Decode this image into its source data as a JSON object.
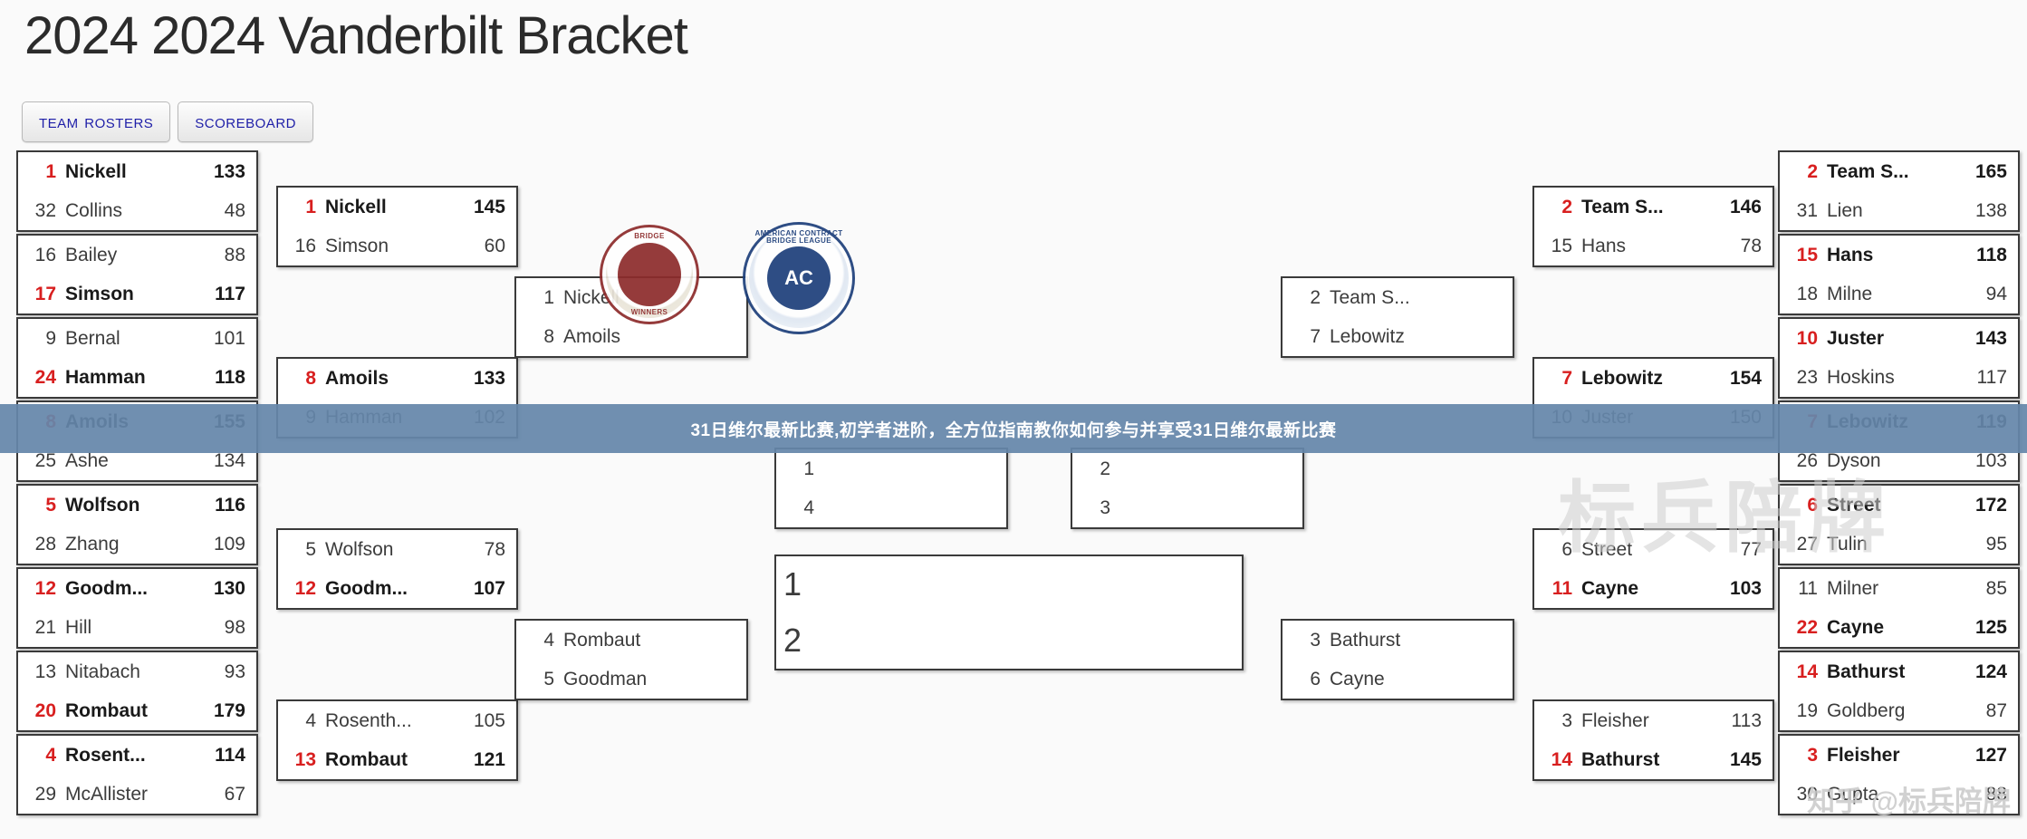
{
  "header": {
    "title": "2024 2024 Vanderbilt Bracket"
  },
  "tabs": [
    {
      "label": "Team Rosters"
    },
    {
      "label": "Scoreboard"
    }
  ],
  "overlay": {
    "banner_text": "31日维尔最新比赛,初学者进阶，全方位指南教你如何参与并享受31日维尔最新比赛",
    "watermark": "知乎 @标兵陪牌",
    "watermark_big": "标兵陪牌"
  },
  "logos": [
    {
      "name": "bridge-winners",
      "top_text": "BRIDGE",
      "bottom_text": "WINNERS"
    },
    {
      "name": "acbl",
      "top_text": "AMERICAN CONTRACT BRIDGE LEAGUE",
      "center": "AC"
    }
  ],
  "bracket": {
    "left_r1": [
      {
        "top": {
          "seed": "1",
          "name": "Nickell",
          "score": "133",
          "winner": true
        },
        "bot": {
          "seed": "32",
          "name": "Collins",
          "score": "48",
          "winner": false
        }
      },
      {
        "top": {
          "seed": "16",
          "name": "Bailey",
          "score": "88",
          "winner": false
        },
        "bot": {
          "seed": "17",
          "name": "Simson",
          "score": "117",
          "winner": true
        }
      },
      {
        "top": {
          "seed": "9",
          "name": "Bernal",
          "score": "101",
          "winner": false
        },
        "bot": {
          "seed": "24",
          "name": "Hamman",
          "score": "118",
          "winner": true
        }
      },
      {
        "top": {
          "seed": "8",
          "name": "Amoils",
          "score": "155",
          "winner": true
        },
        "bot": {
          "seed": "25",
          "name": "Ashe",
          "score": "134",
          "winner": false
        }
      },
      {
        "top": {
          "seed": "5",
          "name": "Wolfson",
          "score": "116",
          "winner": true
        },
        "bot": {
          "seed": "28",
          "name": "Zhang",
          "score": "109",
          "winner": false
        }
      },
      {
        "top": {
          "seed": "12",
          "name": "Goodm...",
          "score": "130",
          "winner": true
        },
        "bot": {
          "seed": "21",
          "name": "Hill",
          "score": "98",
          "winner": false
        }
      },
      {
        "top": {
          "seed": "13",
          "name": "Nitabach",
          "score": "93",
          "winner": false
        },
        "bot": {
          "seed": "20",
          "name": "Rombaut",
          "score": "179",
          "winner": true
        }
      },
      {
        "top": {
          "seed": "4",
          "name": "Rosent...",
          "score": "114",
          "winner": true
        },
        "bot": {
          "seed": "29",
          "name": "McAllister",
          "score": "67",
          "winner": false
        }
      }
    ],
    "left_r2": [
      {
        "top": {
          "seed": "1",
          "name": "Nickell",
          "score": "145",
          "winner": true
        },
        "bot": {
          "seed": "16",
          "name": "Simson",
          "score": "60",
          "winner": false
        }
      },
      {
        "top": {
          "seed": "8",
          "name": "Amoils",
          "score": "133",
          "winner": true
        },
        "bot": {
          "seed": "9",
          "name": "Hamman",
          "score": "102",
          "winner": false
        }
      },
      {
        "top": {
          "seed": "5",
          "name": "Wolfson",
          "score": "78",
          "winner": false
        },
        "bot": {
          "seed": "12",
          "name": "Goodm...",
          "score": "107",
          "winner": true
        }
      },
      {
        "top": {
          "seed": "4",
          "name": "Rosenth...",
          "score": "105",
          "winner": false
        },
        "bot": {
          "seed": "13",
          "name": "Rombaut",
          "score": "121",
          "winner": true
        }
      }
    ],
    "left_r3": [
      {
        "top": {
          "seed": "1",
          "name": "Nickell",
          "score": "",
          "winner": false
        },
        "bot": {
          "seed": "8",
          "name": "Amoils",
          "score": "",
          "winner": false
        }
      },
      {
        "top": {
          "seed": "4",
          "name": "Rombaut",
          "score": "",
          "winner": false
        },
        "bot": {
          "seed": "5",
          "name": "Goodman",
          "score": "",
          "winner": false
        }
      }
    ],
    "left_r4": [
      {
        "top": {
          "seed": "1",
          "name": "",
          "score": "",
          "winner": false
        },
        "bot": {
          "seed": "4",
          "name": "",
          "score": "",
          "winner": false
        }
      }
    ],
    "final": [
      {
        "top": {
          "seed": "1",
          "name": "",
          "score": "",
          "winner": false
        },
        "bot": {
          "seed": "2",
          "name": "",
          "score": "",
          "winner": false
        }
      }
    ],
    "right_r4": [
      {
        "top": {
          "seed": "2",
          "name": "",
          "score": "",
          "winner": false
        },
        "bot": {
          "seed": "3",
          "name": "",
          "score": "",
          "winner": false
        }
      }
    ],
    "right_r3": [
      {
        "top": {
          "seed": "2",
          "name": "Team S...",
          "score": "",
          "winner": false
        },
        "bot": {
          "seed": "7",
          "name": "Lebowitz",
          "score": "",
          "winner": false
        }
      },
      {
        "top": {
          "seed": "3",
          "name": "Bathurst",
          "score": "",
          "winner": false
        },
        "bot": {
          "seed": "6",
          "name": "Cayne",
          "score": "",
          "winner": false
        }
      }
    ],
    "right_r2": [
      {
        "top": {
          "seed": "2",
          "name": "Team S...",
          "score": "146",
          "winner": true
        },
        "bot": {
          "seed": "15",
          "name": "Hans",
          "score": "78",
          "winner": false
        }
      },
      {
        "top": {
          "seed": "7",
          "name": "Lebowitz",
          "score": "154",
          "winner": true
        },
        "bot": {
          "seed": "10",
          "name": "Juster",
          "score": "150",
          "winner": false
        }
      },
      {
        "top": {
          "seed": "6",
          "name": "Street",
          "score": "77",
          "winner": false
        },
        "bot": {
          "seed": "11",
          "name": "Cayne",
          "score": "103",
          "winner": true
        }
      },
      {
        "top": {
          "seed": "3",
          "name": "Fleisher",
          "score": "113",
          "winner": false
        },
        "bot": {
          "seed": "14",
          "name": "Bathurst",
          "score": "145",
          "winner": true
        }
      }
    ],
    "right_r1": [
      {
        "top": {
          "seed": "2",
          "name": "Team S...",
          "score": "165",
          "winner": true
        },
        "bot": {
          "seed": "31",
          "name": "Lien",
          "score": "138",
          "winner": false
        }
      },
      {
        "top": {
          "seed": "15",
          "name": "Hans",
          "score": "118",
          "winner": true
        },
        "bot": {
          "seed": "18",
          "name": "Milne",
          "score": "94",
          "winner": false
        }
      },
      {
        "top": {
          "seed": "10",
          "name": "Juster",
          "score": "143",
          "winner": true
        },
        "bot": {
          "seed": "23",
          "name": "Hoskins",
          "score": "117",
          "winner": false
        }
      },
      {
        "top": {
          "seed": "7",
          "name": "Lebowitz",
          "score": "119",
          "winner": true
        },
        "bot": {
          "seed": "26",
          "name": "Dyson",
          "score": "103",
          "winner": false
        }
      },
      {
        "top": {
          "seed": "6",
          "name": "Street",
          "score": "172",
          "winner": true
        },
        "bot": {
          "seed": "27",
          "name": "Tulin",
          "score": "95",
          "winner": false
        }
      },
      {
        "top": {
          "seed": "11",
          "name": "Milner",
          "score": "85",
          "winner": false
        },
        "bot": {
          "seed": "22",
          "name": "Cayne",
          "score": "125",
          "winner": true
        }
      },
      {
        "top": {
          "seed": "14",
          "name": "Bathurst",
          "score": "124",
          "winner": true
        },
        "bot": {
          "seed": "19",
          "name": "Goldberg",
          "score": "87",
          "winner": false
        }
      },
      {
        "top": {
          "seed": "3",
          "name": "Fleisher",
          "score": "127",
          "winner": true
        },
        "bot": {
          "seed": "30",
          "name": "Gupta",
          "score": "88",
          "winner": false
        }
      }
    ]
  }
}
